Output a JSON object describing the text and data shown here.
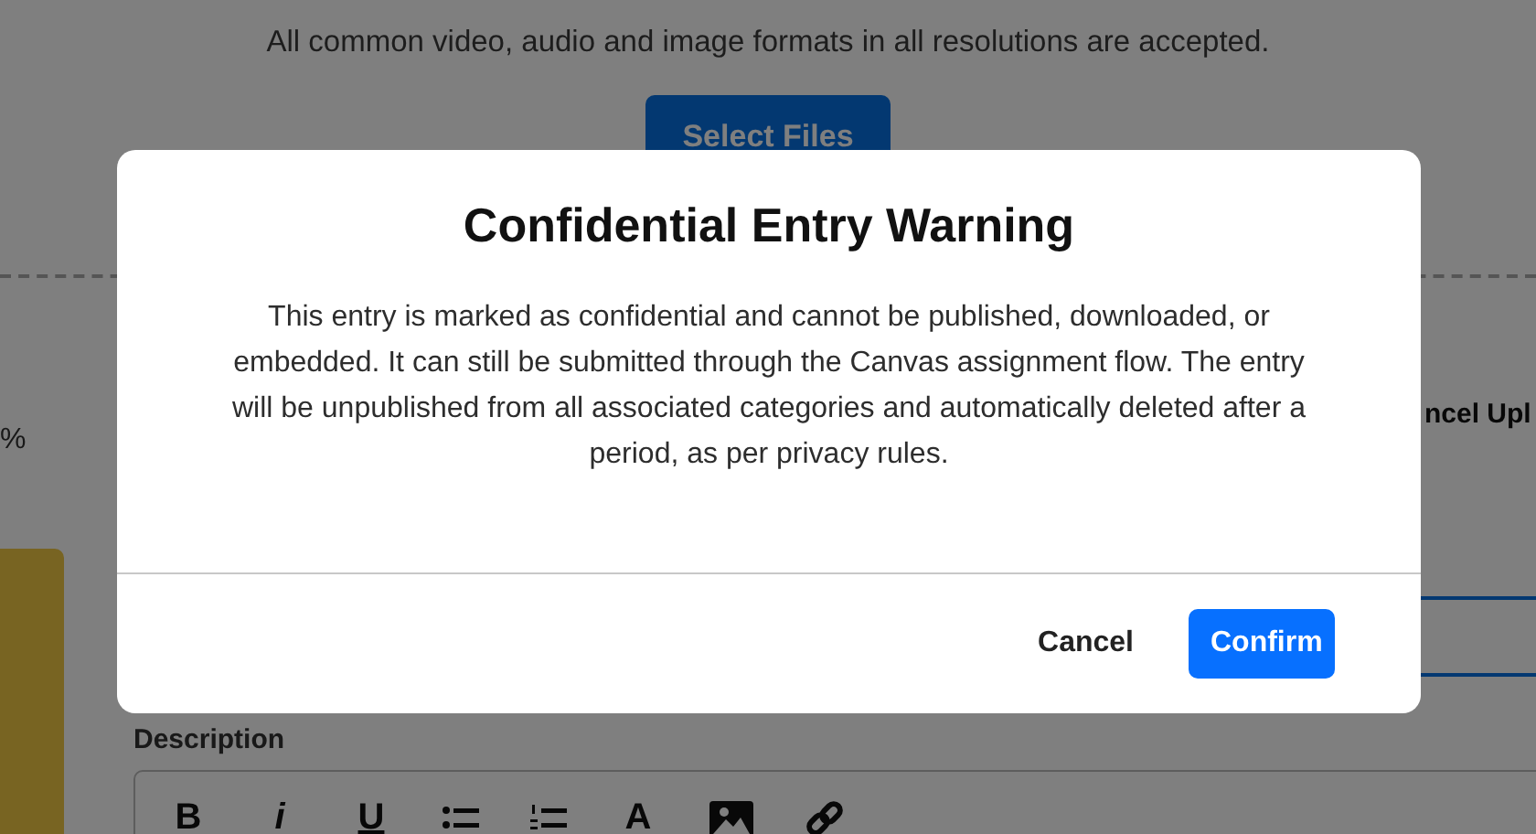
{
  "page": {
    "formats_note": "All common video, audio and image formats in all resolutions are accepted.",
    "select_button": "Select Files",
    "progress_fragment": "%",
    "cancel_fragment": "ncel Upl",
    "description_label": "Description",
    "toolbar": [
      {
        "kind": "bold",
        "label": "B"
      },
      {
        "kind": "italic",
        "label": "i"
      },
      {
        "kind": "underline",
        "label": "U"
      },
      {
        "kind": "bullets"
      },
      {
        "kind": "numbers"
      },
      {
        "kind": "color",
        "label": "A"
      },
      {
        "kind": "image"
      },
      {
        "kind": "link"
      }
    ]
  },
  "dialog": {
    "title": "Confidential Entry Warning",
    "message": "This entry is marked as confidential and cannot be published, downloaded, or embedded. It can still be submitted through the Canvas assignment flow. The entry will be unpublished from all associated categories and automatically deleted after a period, as per privacy rules.",
    "buttons": [
      {
        "kind": "secondary",
        "label": "Cancel"
      },
      {
        "kind": "primary",
        "label": "Confirm"
      }
    ]
  }
}
